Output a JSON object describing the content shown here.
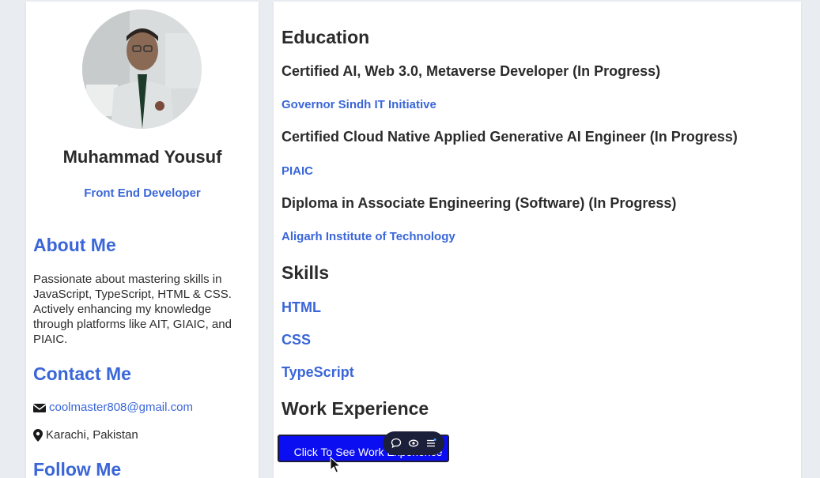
{
  "profile": {
    "name": "Muhammad Yousuf",
    "role": "Front End Developer"
  },
  "about": {
    "heading": "About Me",
    "text": "Passionate about mastering skills in JavaScript, TypeScript, HTML & CSS. Actively enhancing my knowledge through platforms like AIT, GIAIC, and PIAIC."
  },
  "contact": {
    "heading": "Contact Me",
    "email": "coolmaster808@gmail.com",
    "location": "Karachi, Pakistan"
  },
  "follow": {
    "heading": "Follow Me"
  },
  "education": {
    "heading": "Education",
    "items": [
      {
        "degree": "Certified AI, Web 3.0, Metaverse Developer (In Progress)",
        "institute": "Governor Sindh IT Initiative"
      },
      {
        "degree": "Certified Cloud Native Applied Generative AI Engineer (In Progress)",
        "institute": "PIAIC"
      },
      {
        "degree": "Diploma in Associate Engineering (Software) (In Progress)",
        "institute": "Aligarh Institute of Technology"
      }
    ]
  },
  "skills": {
    "heading": "Skills",
    "items": [
      "HTML",
      "CSS",
      "TypeScript"
    ]
  },
  "work": {
    "heading": "Work Experience",
    "button_label": "Click To See Work Experience"
  },
  "toolbar": {
    "icons": [
      "comment-icon",
      "eye-icon",
      "list-icon"
    ]
  },
  "colors": {
    "accent": "#3a66d8",
    "button": "#0a0ef0",
    "text": "#2b2b2b",
    "background": "#e9ecf1"
  }
}
